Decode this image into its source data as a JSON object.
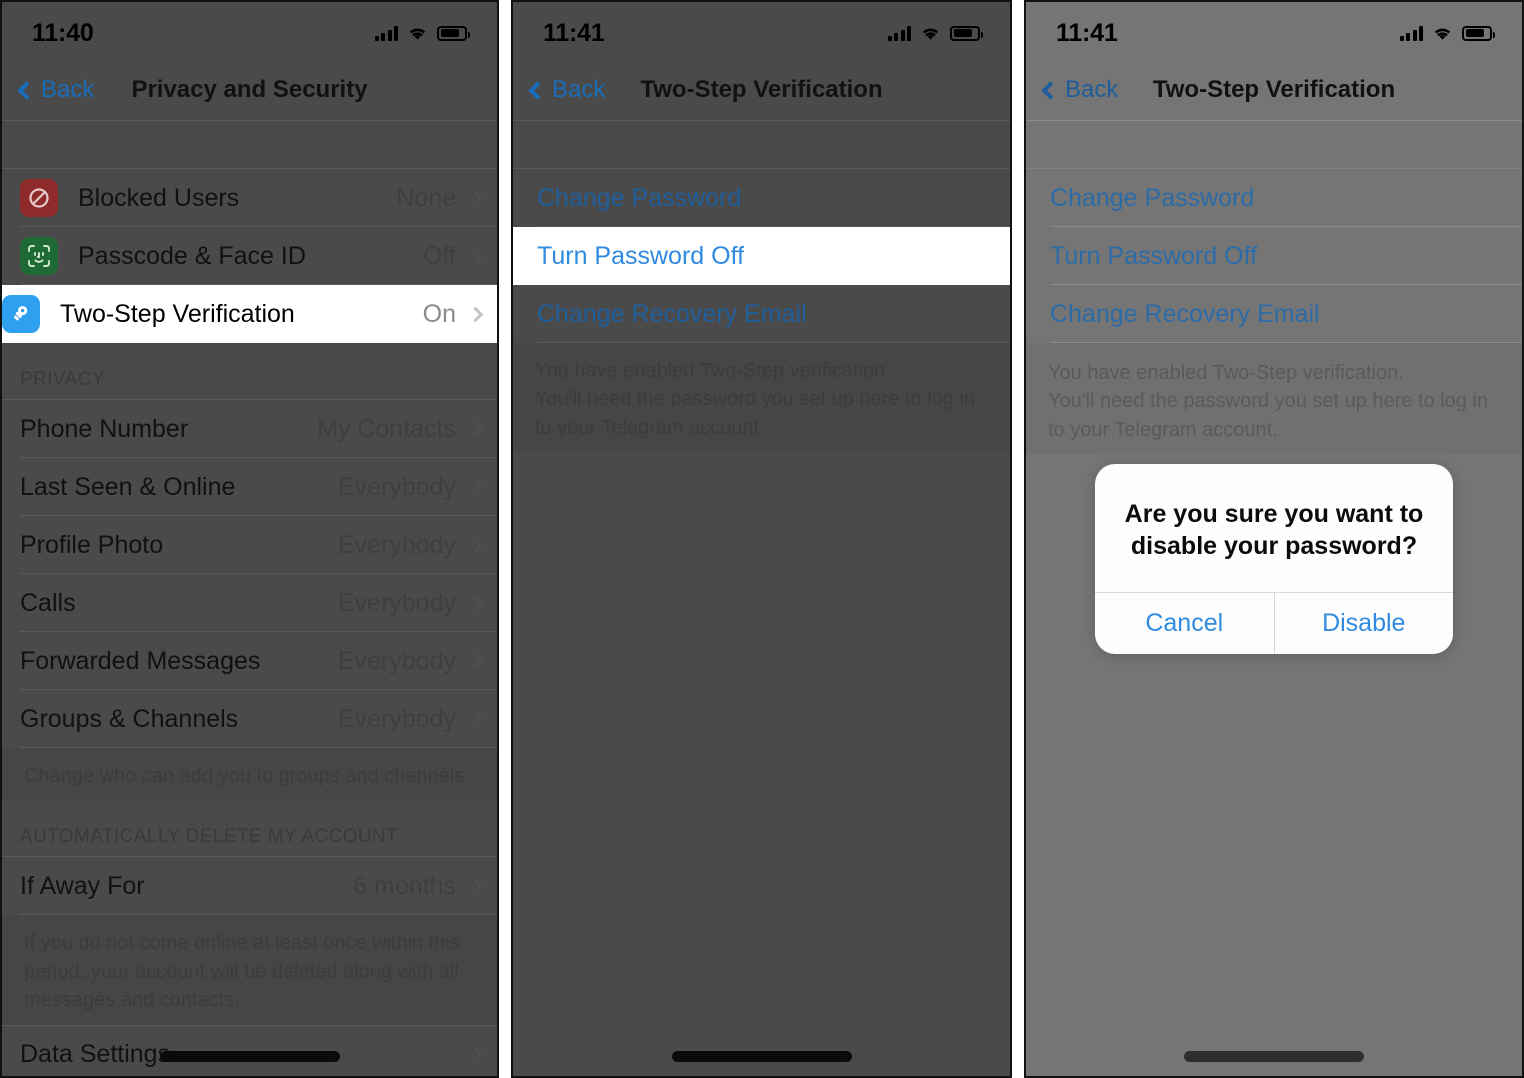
{
  "panels": [
    {
      "status": {
        "time": "11:40",
        "signal_icon": "cellular-bars-icon",
        "wifi_icon": "wifi-icon",
        "battery_icon": "battery-icon"
      },
      "nav": {
        "back_label": "Back",
        "title": "Privacy and Security"
      },
      "security_rows": [
        {
          "icon": "blocked-users-icon",
          "label": "Blocked Users",
          "value": "None",
          "highlight": false
        },
        {
          "icon": "face-id-icon",
          "label": "Passcode & Face ID",
          "value": "Off",
          "highlight": false
        },
        {
          "icon": "key-icon",
          "label": "Two-Step Verification",
          "value": "On",
          "highlight": true
        }
      ],
      "privacy_header": "PRIVACY",
      "privacy_rows": [
        {
          "label": "Phone Number",
          "value": "My Contacts"
        },
        {
          "label": "Last Seen & Online",
          "value": "Everybody"
        },
        {
          "label": "Profile Photo",
          "value": "Everybody"
        },
        {
          "label": "Calls",
          "value": "Everybody"
        },
        {
          "label": "Forwarded Messages",
          "value": "Everybody"
        },
        {
          "label": "Groups & Channels",
          "value": "Everybody"
        }
      ],
      "privacy_footer": "Change who can add you to groups and channels.",
      "delete_header": "AUTOMATICALLY DELETE MY ACCOUNT",
      "delete_row": {
        "label": "If Away For",
        "value": "6 months"
      },
      "delete_footer": "If you do not come online at least once within this period, your account will be deleted along with all messages and contacts.",
      "data_settings_row": {
        "label": "Data Settings",
        "value": ""
      }
    },
    {
      "status": {
        "time": "11:41",
        "signal_icon": "cellular-bars-icon",
        "wifi_icon": "wifi-icon",
        "battery_icon": "battery-icon"
      },
      "nav": {
        "back_label": "Back",
        "title": "Two-Step Verification"
      },
      "links": [
        {
          "label": "Change Password",
          "highlight": false
        },
        {
          "label": "Turn Password Off",
          "highlight": true
        },
        {
          "label": "Change Recovery Email",
          "highlight": false
        }
      ],
      "footer": "You have enabled Two-Step verification.\nYou'll need the password you set up here to log in to your Telegram account."
    },
    {
      "status": {
        "time": "11:41",
        "signal_icon": "cellular-bars-icon",
        "wifi_icon": "wifi-icon",
        "battery_icon": "battery-icon"
      },
      "nav": {
        "back_label": "Back",
        "title": "Two-Step Verification"
      },
      "links": [
        {
          "label": "Change Password",
          "highlight": false
        },
        {
          "label": "Turn Password Off",
          "highlight": false
        },
        {
          "label": "Change Recovery Email",
          "highlight": false
        }
      ],
      "footer": "You have enabled Two-Step verification.\nYou'll need the password you set up here to log in to your Telegram account.",
      "alert": {
        "title": "Are you sure you want to disable your password?",
        "cancel_label": "Cancel",
        "confirm_label": "Disable"
      }
    }
  ],
  "colors": {
    "link_blue": "#2f8ae0",
    "highlight_white": "#ffffff",
    "dim_overlay_dark": "#4a4a4a",
    "dim_overlay_light": "#757575",
    "icon_red": "#8e2a2a",
    "icon_green": "#1f6a34",
    "icon_blue": "#2f9ff0"
  }
}
